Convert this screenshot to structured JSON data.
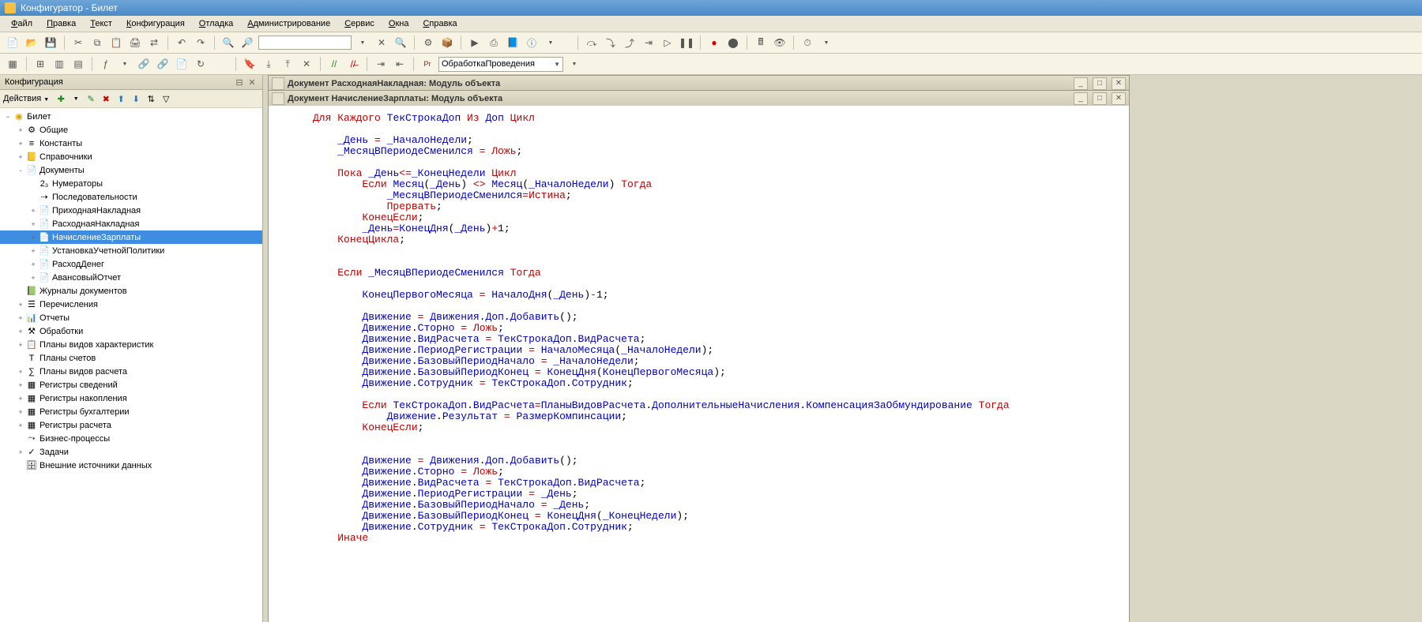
{
  "title": "Конфигуратор - Билет",
  "menus": [
    "Файл",
    "Правка",
    "Текст",
    "Конфигурация",
    "Отладка",
    "Администрирование",
    "Сервис",
    "Окна",
    "Справка"
  ],
  "combo_proc": "ОбработкаПроведения",
  "sidebar": {
    "title": "Конфигурация",
    "actions_label": "Действия",
    "root": "Билет",
    "nodes": [
      {
        "l": "Общие",
        "d": 1,
        "e": "+",
        "i": "⚙"
      },
      {
        "l": "Константы",
        "d": 1,
        "e": "+",
        "i": "≡"
      },
      {
        "l": "Справочники",
        "d": 1,
        "e": "+",
        "i": "📒"
      },
      {
        "l": "Документы",
        "d": 1,
        "e": "-",
        "i": "📄"
      },
      {
        "l": "Нумераторы",
        "d": 2,
        "e": "",
        "i": "2₃"
      },
      {
        "l": "Последовательности",
        "d": 2,
        "e": "",
        "i": "⇢"
      },
      {
        "l": "ПриходнаяНакладная",
        "d": 2,
        "e": "+",
        "i": "📄"
      },
      {
        "l": "РасходнаяНакладная",
        "d": 2,
        "e": "+",
        "i": "📄"
      },
      {
        "l": "НачислениеЗарплаты",
        "d": 2,
        "e": "+",
        "i": "📄",
        "sel": true
      },
      {
        "l": "УстановкаУчетнойПолитики",
        "d": 2,
        "e": "+",
        "i": "📄"
      },
      {
        "l": "РасходДенег",
        "d": 2,
        "e": "+",
        "i": "📄"
      },
      {
        "l": "АвансовыйОтчет",
        "d": 2,
        "e": "+",
        "i": "📄"
      },
      {
        "l": "Журналы документов",
        "d": 1,
        "e": "",
        "i": "📗"
      },
      {
        "l": "Перечисления",
        "d": 1,
        "e": "+",
        "i": "☰"
      },
      {
        "l": "Отчеты",
        "d": 1,
        "e": "+",
        "i": "📊"
      },
      {
        "l": "Обработки",
        "d": 1,
        "e": "+",
        "i": "⚒"
      },
      {
        "l": "Планы видов характеристик",
        "d": 1,
        "e": "+",
        "i": "📋"
      },
      {
        "l": "Планы счетов",
        "d": 1,
        "e": "",
        "i": "T"
      },
      {
        "l": "Планы видов расчета",
        "d": 1,
        "e": "+",
        "i": "∑"
      },
      {
        "l": "Регистры сведений",
        "d": 1,
        "e": "+",
        "i": "▦"
      },
      {
        "l": "Регистры накопления",
        "d": 1,
        "e": "+",
        "i": "▦"
      },
      {
        "l": "Регистры бухгалтерии",
        "d": 1,
        "e": "+",
        "i": "▦"
      },
      {
        "l": "Регистры расчета",
        "d": 1,
        "e": "+",
        "i": "▦"
      },
      {
        "l": "Бизнес-процессы",
        "d": 1,
        "e": "",
        "i": "⤳"
      },
      {
        "l": "Задачи",
        "d": 1,
        "e": "+",
        "i": "✓"
      },
      {
        "l": "Внешние источники данных",
        "d": 1,
        "e": "",
        "i": "🗄"
      }
    ]
  },
  "doc_back_title": "Документ РасходнаяНакладная: Модуль объекта",
  "doc_front_title": "Документ НачислениеЗарплаты: Модуль объекта",
  "code_tokens": [
    [
      [
        "kw",
        "Для"
      ],
      [
        "sp",
        " "
      ],
      [
        "kw",
        "Каждого"
      ],
      [
        "sp",
        " "
      ],
      [
        "id",
        "ТекСтрокаДоп"
      ],
      [
        "sp",
        " "
      ],
      [
        "kw",
        "Из"
      ],
      [
        "sp",
        " "
      ],
      [
        "id",
        "Доп"
      ],
      [
        "sp",
        " "
      ],
      [
        "kw",
        "Цикл"
      ]
    ],
    [],
    [
      [
        "sp",
        "    "
      ],
      [
        "id",
        "_День"
      ],
      [
        "sp",
        " "
      ],
      [
        "op",
        "="
      ],
      [
        "sp",
        " "
      ],
      [
        "id",
        "_НачалоНедели"
      ],
      [
        "t",
        ";"
      ]
    ],
    [
      [
        "sp",
        "    "
      ],
      [
        "id",
        "_МесяцВПериодеСменился"
      ],
      [
        "sp",
        " "
      ],
      [
        "op",
        "="
      ],
      [
        "sp",
        " "
      ],
      [
        "kw",
        "Ложь"
      ],
      [
        "t",
        ";"
      ]
    ],
    [],
    [
      [
        "sp",
        "    "
      ],
      [
        "kw",
        "Пока"
      ],
      [
        "sp",
        " "
      ],
      [
        "id",
        "_День"
      ],
      [
        "op",
        "<="
      ],
      [
        "id",
        "_КонецНедели"
      ],
      [
        "sp",
        " "
      ],
      [
        "kw",
        "Цикл"
      ]
    ],
    [
      [
        "sp",
        "        "
      ],
      [
        "kw",
        "Если"
      ],
      [
        "sp",
        " "
      ],
      [
        "id",
        "Месяц"
      ],
      [
        "t",
        "("
      ],
      [
        "id",
        "_День"
      ],
      [
        "t",
        ")"
      ],
      [
        "sp",
        " "
      ],
      [
        "op",
        "<>"
      ],
      [
        "sp",
        " "
      ],
      [
        "id",
        "Месяц"
      ],
      [
        "t",
        "("
      ],
      [
        "id",
        "_НачалоНедели"
      ],
      [
        "t",
        ")"
      ],
      [
        "sp",
        " "
      ],
      [
        "kw",
        "Тогда"
      ]
    ],
    [
      [
        "sp",
        "            "
      ],
      [
        "id",
        "_МесяцВПериодеСменился"
      ],
      [
        "op",
        "="
      ],
      [
        "kw",
        "Истина"
      ],
      [
        "t",
        ";"
      ]
    ],
    [
      [
        "sp",
        "            "
      ],
      [
        "kw",
        "Прервать"
      ],
      [
        "t",
        ";"
      ]
    ],
    [
      [
        "sp",
        "        "
      ],
      [
        "kw",
        "КонецЕсли"
      ],
      [
        "t",
        ";"
      ]
    ],
    [
      [
        "sp",
        "        "
      ],
      [
        "id",
        "_День"
      ],
      [
        "op",
        "="
      ],
      [
        "id",
        "КонецДня"
      ],
      [
        "t",
        "("
      ],
      [
        "id",
        "_День"
      ],
      [
        "t",
        ")"
      ],
      [
        "op",
        "+"
      ],
      [
        "t",
        "1;"
      ]
    ],
    [
      [
        "sp",
        "    "
      ],
      [
        "kw",
        "КонецЦикла"
      ],
      [
        "t",
        ";"
      ]
    ],
    [],
    [],
    [
      [
        "sp",
        "    "
      ],
      [
        "kw",
        "Если"
      ],
      [
        "sp",
        " "
      ],
      [
        "id",
        "_МесяцВПериодеСменился"
      ],
      [
        "sp",
        " "
      ],
      [
        "kw",
        "Тогда"
      ]
    ],
    [],
    [
      [
        "sp",
        "        "
      ],
      [
        "id",
        "КонецПервогоМесяца"
      ],
      [
        "sp",
        " "
      ],
      [
        "op",
        "="
      ],
      [
        "sp",
        " "
      ],
      [
        "id",
        "НачалоДня"
      ],
      [
        "t",
        "("
      ],
      [
        "id",
        "_День"
      ],
      [
        "t",
        ")"
      ],
      [
        "op",
        "-"
      ],
      [
        "t",
        "1;"
      ]
    ],
    [],
    [
      [
        "sp",
        "        "
      ],
      [
        "id",
        "Движение"
      ],
      [
        "sp",
        " "
      ],
      [
        "op",
        "="
      ],
      [
        "sp",
        " "
      ],
      [
        "id",
        "Движения"
      ],
      [
        "t",
        "."
      ],
      [
        "id",
        "Доп"
      ],
      [
        "t",
        "."
      ],
      [
        "id",
        "Добавить"
      ],
      [
        "t",
        "();"
      ]
    ],
    [
      [
        "sp",
        "        "
      ],
      [
        "id",
        "Движение"
      ],
      [
        "t",
        "."
      ],
      [
        "id",
        "Сторно"
      ],
      [
        "sp",
        " "
      ],
      [
        "op",
        "="
      ],
      [
        "sp",
        " "
      ],
      [
        "kw",
        "Ложь"
      ],
      [
        "t",
        ";"
      ]
    ],
    [
      [
        "sp",
        "        "
      ],
      [
        "id",
        "Движение"
      ],
      [
        "t",
        "."
      ],
      [
        "id",
        "ВидРасчета"
      ],
      [
        "sp",
        " "
      ],
      [
        "op",
        "="
      ],
      [
        "sp",
        " "
      ],
      [
        "id",
        "ТекСтрокаДоп"
      ],
      [
        "t",
        "."
      ],
      [
        "id",
        "ВидРасчета"
      ],
      [
        "t",
        ";"
      ]
    ],
    [
      [
        "sp",
        "        "
      ],
      [
        "id",
        "Движение"
      ],
      [
        "t",
        "."
      ],
      [
        "id",
        "ПериодРегистрации"
      ],
      [
        "sp",
        " "
      ],
      [
        "op",
        "="
      ],
      [
        "sp",
        " "
      ],
      [
        "id",
        "НачалоМесяца"
      ],
      [
        "t",
        "("
      ],
      [
        "id",
        "_НачалоНедели"
      ],
      [
        "t",
        ");"
      ]
    ],
    [
      [
        "sp",
        "        "
      ],
      [
        "id",
        "Движение"
      ],
      [
        "t",
        "."
      ],
      [
        "id",
        "БазовыйПериодНачало"
      ],
      [
        "sp",
        " "
      ],
      [
        "op",
        "="
      ],
      [
        "sp",
        " "
      ],
      [
        "id",
        "_НачалоНедели"
      ],
      [
        "t",
        ";"
      ]
    ],
    [
      [
        "sp",
        "        "
      ],
      [
        "id",
        "Движение"
      ],
      [
        "t",
        "."
      ],
      [
        "id",
        "БазовыйПериодКонец"
      ],
      [
        "sp",
        " "
      ],
      [
        "op",
        "="
      ],
      [
        "sp",
        " "
      ],
      [
        "id",
        "КонецДня"
      ],
      [
        "t",
        "("
      ],
      [
        "id",
        "КонецПервогоМесяца"
      ],
      [
        "t",
        ");"
      ]
    ],
    [
      [
        "sp",
        "        "
      ],
      [
        "id",
        "Движение"
      ],
      [
        "t",
        "."
      ],
      [
        "id",
        "Сотрудник"
      ],
      [
        "sp",
        " "
      ],
      [
        "op",
        "="
      ],
      [
        "sp",
        " "
      ],
      [
        "id",
        "ТекСтрокаДоп"
      ],
      [
        "t",
        "."
      ],
      [
        "id",
        "Сотрудник"
      ],
      [
        "t",
        ";"
      ]
    ],
    [],
    [
      [
        "sp",
        "        "
      ],
      [
        "kw",
        "Если"
      ],
      [
        "sp",
        " "
      ],
      [
        "id",
        "ТекСтрокаДоп"
      ],
      [
        "t",
        "."
      ],
      [
        "id",
        "ВидРасчета"
      ],
      [
        "op",
        "="
      ],
      [
        "id",
        "ПланыВидовРасчета"
      ],
      [
        "t",
        "."
      ],
      [
        "id",
        "ДополнительныеНачисления"
      ],
      [
        "t",
        "."
      ],
      [
        "id",
        "КомпенсацияЗаОбмундирование"
      ],
      [
        "sp",
        " "
      ],
      [
        "kw",
        "Тогда"
      ]
    ],
    [
      [
        "sp",
        "            "
      ],
      [
        "id",
        "Движение"
      ],
      [
        "t",
        "."
      ],
      [
        "id",
        "Результат"
      ],
      [
        "sp",
        " "
      ],
      [
        "op",
        "="
      ],
      [
        "sp",
        " "
      ],
      [
        "id",
        "РазмерКомпинсации"
      ],
      [
        "t",
        ";"
      ]
    ],
    [
      [
        "sp",
        "        "
      ],
      [
        "kw",
        "КонецЕсли"
      ],
      [
        "t",
        ";"
      ]
    ],
    [],
    [],
    [
      [
        "sp",
        "        "
      ],
      [
        "id",
        "Движение"
      ],
      [
        "sp",
        " "
      ],
      [
        "op",
        "="
      ],
      [
        "sp",
        " "
      ],
      [
        "id",
        "Движения"
      ],
      [
        "t",
        "."
      ],
      [
        "id",
        "Доп"
      ],
      [
        "t",
        "."
      ],
      [
        "id",
        "Добавить"
      ],
      [
        "t",
        "();"
      ]
    ],
    [
      [
        "sp",
        "        "
      ],
      [
        "id",
        "Движение"
      ],
      [
        "t",
        "."
      ],
      [
        "id",
        "Сторно"
      ],
      [
        "sp",
        " "
      ],
      [
        "op",
        "="
      ],
      [
        "sp",
        " "
      ],
      [
        "kw",
        "Ложь"
      ],
      [
        "t",
        ";"
      ]
    ],
    [
      [
        "sp",
        "        "
      ],
      [
        "id",
        "Движение"
      ],
      [
        "t",
        "."
      ],
      [
        "id",
        "ВидРасчета"
      ],
      [
        "sp",
        " "
      ],
      [
        "op",
        "="
      ],
      [
        "sp",
        " "
      ],
      [
        "id",
        "ТекСтрокаДоп"
      ],
      [
        "t",
        "."
      ],
      [
        "id",
        "ВидРасчета"
      ],
      [
        "t",
        ";"
      ]
    ],
    [
      [
        "sp",
        "        "
      ],
      [
        "id",
        "Движение"
      ],
      [
        "t",
        "."
      ],
      [
        "id",
        "ПериодРегистрации"
      ],
      [
        "sp",
        " "
      ],
      [
        "op",
        "="
      ],
      [
        "sp",
        " "
      ],
      [
        "id",
        "_День"
      ],
      [
        "t",
        ";"
      ]
    ],
    [
      [
        "sp",
        "        "
      ],
      [
        "id",
        "Движение"
      ],
      [
        "t",
        "."
      ],
      [
        "id",
        "БазовыйПериодНачало"
      ],
      [
        "sp",
        " "
      ],
      [
        "op",
        "="
      ],
      [
        "sp",
        " "
      ],
      [
        "id",
        "_День"
      ],
      [
        "t",
        ";"
      ]
    ],
    [
      [
        "sp",
        "        "
      ],
      [
        "id",
        "Движение"
      ],
      [
        "t",
        "."
      ],
      [
        "id",
        "БазовыйПериодКонец"
      ],
      [
        "sp",
        " "
      ],
      [
        "op",
        "="
      ],
      [
        "sp",
        " "
      ],
      [
        "id",
        "КонецДня"
      ],
      [
        "t",
        "("
      ],
      [
        "id",
        "_КонецНедели"
      ],
      [
        "t",
        ");"
      ]
    ],
    [
      [
        "sp",
        "        "
      ],
      [
        "id",
        "Движение"
      ],
      [
        "t",
        "."
      ],
      [
        "id",
        "Сотрудник"
      ],
      [
        "sp",
        " "
      ],
      [
        "op",
        "="
      ],
      [
        "sp",
        " "
      ],
      [
        "id",
        "ТекСтрокаДоп"
      ],
      [
        "t",
        "."
      ],
      [
        "id",
        "Сотрудник"
      ],
      [
        "t",
        ";"
      ]
    ],
    [
      [
        "sp",
        "    "
      ],
      [
        "kw",
        "Иначе"
      ]
    ]
  ]
}
